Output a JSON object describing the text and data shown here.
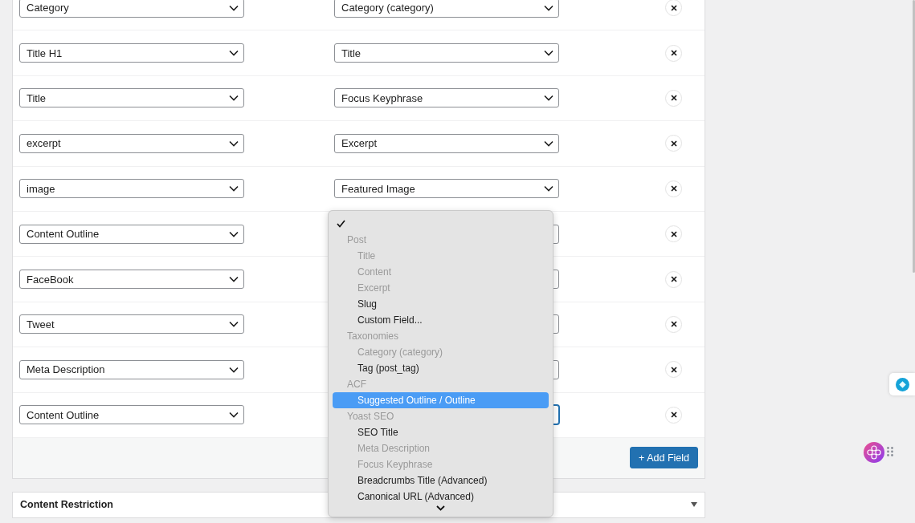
{
  "mappings": [
    {
      "field": "Category",
      "target": "Category (category)",
      "focused": false
    },
    {
      "field": "Title H1",
      "target": "Title",
      "focused": false
    },
    {
      "field": "Title",
      "target": "Focus Keyphrase",
      "focused": false
    },
    {
      "field": "excerpt",
      "target": "Excerpt",
      "focused": false
    },
    {
      "field": "image",
      "target": "Featured Image",
      "focused": false
    },
    {
      "field": "Content Outline",
      "focused": false
    },
    {
      "field": "FaceBook",
      "focused": false
    },
    {
      "field": "Tweet",
      "focused": false
    },
    {
      "field": "Meta Description",
      "focused": false
    },
    {
      "field": "Content Outline",
      "focused": true
    }
  ],
  "add_button": "+ Add Field",
  "section": {
    "title": "Content Restriction"
  },
  "dropdown": {
    "items": [
      {
        "kind": "check"
      },
      {
        "kind": "group",
        "label": "Post"
      },
      {
        "kind": "option",
        "label": "Title",
        "disabled": true,
        "selected": false
      },
      {
        "kind": "option",
        "label": "Content",
        "disabled": true,
        "selected": false
      },
      {
        "kind": "option",
        "label": "Excerpt",
        "disabled": true,
        "selected": false
      },
      {
        "kind": "option",
        "label": "Slug",
        "disabled": false,
        "selected": false
      },
      {
        "kind": "option",
        "label": "Custom Field...",
        "disabled": false,
        "selected": false
      },
      {
        "kind": "group",
        "label": "Taxonomies"
      },
      {
        "kind": "option",
        "label": "Category (category)",
        "disabled": true,
        "selected": false
      },
      {
        "kind": "option",
        "label": "Tag (post_tag)",
        "disabled": false,
        "selected": false
      },
      {
        "kind": "group",
        "label": "ACF"
      },
      {
        "kind": "option",
        "label": "Suggested Outline / Outline",
        "disabled": false,
        "selected": true
      },
      {
        "kind": "group",
        "label": "Yoast SEO"
      },
      {
        "kind": "option",
        "label": "SEO Title",
        "disabled": false,
        "selected": false
      },
      {
        "kind": "option",
        "label": "Meta Description",
        "disabled": true,
        "selected": false
      },
      {
        "kind": "option",
        "label": "Focus Keyphrase",
        "disabled": true,
        "selected": false
      },
      {
        "kind": "option",
        "label": "Breadcrumbs Title (Advanced)",
        "disabled": false,
        "selected": false
      },
      {
        "kind": "option",
        "label": "Canonical URL (Advanced)",
        "disabled": false,
        "selected": false
      }
    ]
  }
}
